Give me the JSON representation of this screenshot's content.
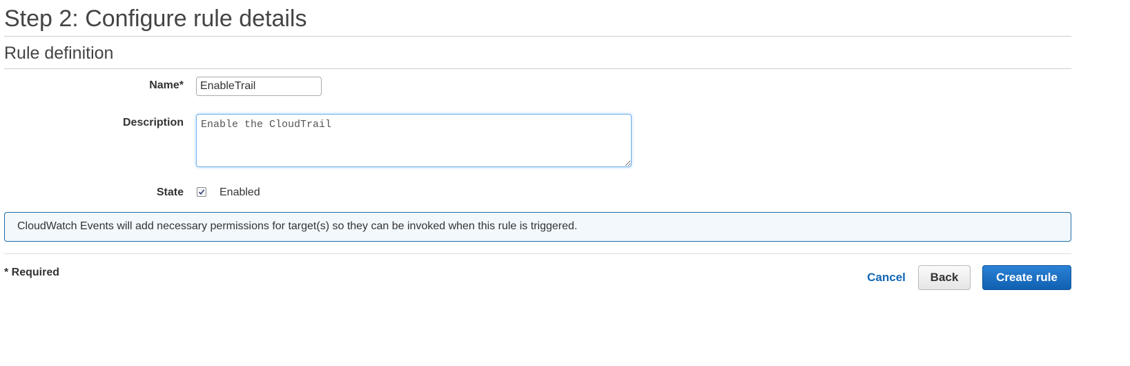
{
  "page": {
    "step_title": "Step 2: Configure rule details",
    "section_title": "Rule definition"
  },
  "form": {
    "name_label": "Name*",
    "name_value": "EnableTrail",
    "description_label": "Description",
    "description_value": "Enable the CloudTrail",
    "state_label": "State",
    "state_checked": true,
    "state_option_label": "Enabled"
  },
  "info": {
    "message": "CloudWatch Events will add necessary permissions for target(s) so they can be invoked when this rule is triggered."
  },
  "footer": {
    "required_note": "* Required",
    "cancel_label": "Cancel",
    "back_label": "Back",
    "create_label": "Create rule"
  },
  "colors": {
    "primary_button": "#1a6ec2",
    "link": "#1066b5",
    "info_border": "#1b6ca7",
    "info_background": "#f2f8fc"
  },
  "icons": {
    "state_checkbox": "checkmark-icon"
  }
}
